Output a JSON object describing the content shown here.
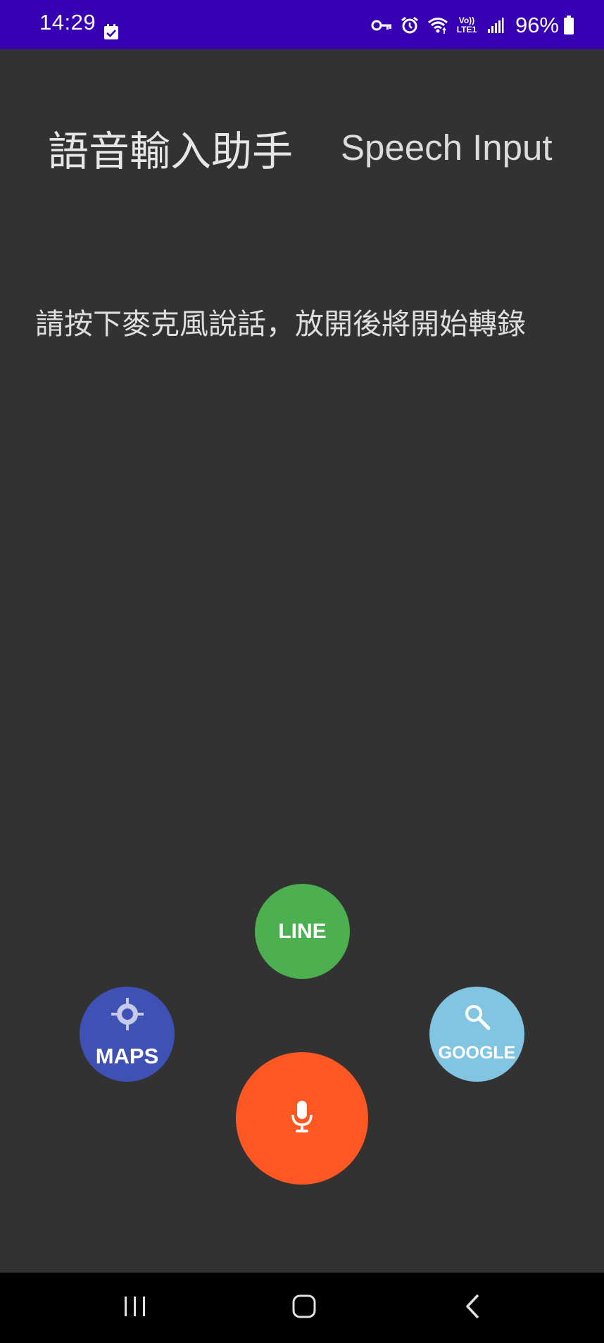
{
  "status_bar": {
    "time": "14:29",
    "battery_percent": "96%",
    "background_color": "#3700b3",
    "icons": [
      "task-check-icon",
      "vpn-key-icon",
      "alarm-icon",
      "wifi-icon",
      "volte-lte-icon",
      "signal-icon",
      "battery-icon"
    ],
    "volte_line1": "Vo))",
    "volte_line2": "LTE1"
  },
  "header": {
    "title_zh": "語音輸入助手",
    "title_en": "Speech Input"
  },
  "main": {
    "instruction": "請按下麥克風說話，放開後將開始轉錄"
  },
  "buttons": {
    "line": {
      "label": "LINE",
      "color": "#4caf50"
    },
    "maps": {
      "label": "MAPS",
      "color": "#3f51b5",
      "icon": "locate-icon"
    },
    "google": {
      "label": "GOOGLE",
      "color": "#81c5e3",
      "icon": "search-icon"
    },
    "mic": {
      "icon": "microphone-icon",
      "color": "#ff5722"
    }
  },
  "nav_bar": {
    "items": [
      "recent-apps-icon",
      "home-icon",
      "back-icon"
    ]
  }
}
